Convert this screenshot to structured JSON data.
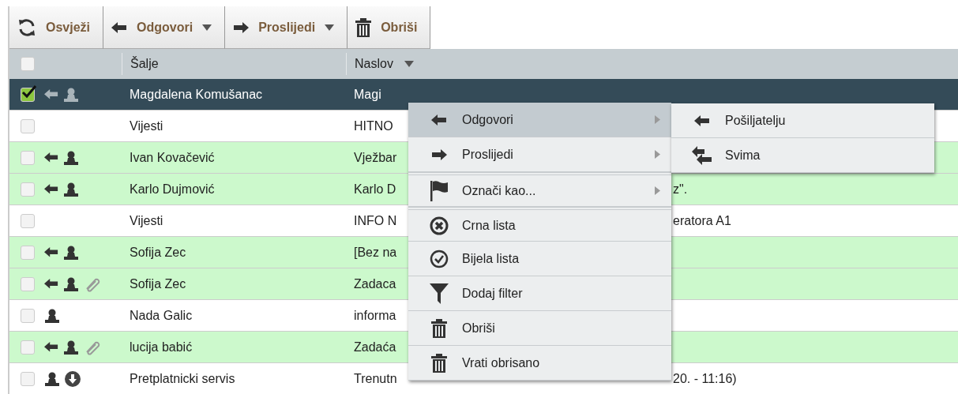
{
  "toolbar": [
    {
      "label": "Osvježi",
      "dropdown": false
    },
    {
      "label": "Odgovori",
      "dropdown": true
    },
    {
      "label": "Proslijedi",
      "dropdown": true
    },
    {
      "label": "Obriši",
      "dropdown": false
    }
  ],
  "table": {
    "select_all_checked": false,
    "columns": [
      {
        "label": "Šalje",
        "sortable": false
      },
      {
        "label": "Naslov",
        "sortable": true
      }
    ],
    "rows": [
      {
        "sender": "Magdalena Komušanac",
        "subject": "Magi",
        "checked": true,
        "selected": true,
        "highlighted": false,
        "status_icons": [
          {
            "kind": "replied"
          },
          {
            "kind": "contact"
          }
        ]
      },
      {
        "sender": "Vijesti",
        "subject": "HITNO",
        "checked": false,
        "selected": false,
        "highlighted": false
      },
      {
        "sender": "Ivan Kovačević",
        "subject": "Vježbar",
        "checked": false,
        "selected": false,
        "highlighted": true,
        "status_icons": [
          {
            "kind": "replied"
          },
          {
            "kind": "contact"
          }
        ]
      },
      {
        "sender": "Karlo Dujmović",
        "subject": "Karlo D",
        "subject_tail": "z\".",
        "checked": false,
        "selected": false,
        "highlighted": true,
        "status_icons": [
          {
            "kind": "replied"
          },
          {
            "kind": "contact"
          }
        ]
      },
      {
        "sender": "Vijesti",
        "subject": "INFO N",
        "subject_tail": "eratora A1",
        "checked": false,
        "selected": false,
        "highlighted": false
      },
      {
        "sender": "Sofija Zec",
        "subject": "[Bez na",
        "checked": false,
        "selected": false,
        "highlighted": true,
        "status_icons": [
          {
            "kind": "replied"
          },
          {
            "kind": "contact"
          }
        ]
      },
      {
        "sender": "Sofija Zec",
        "subject": "Zadaca",
        "checked": false,
        "selected": false,
        "highlighted": true,
        "status_icons": [
          {
            "kind": "replied"
          },
          {
            "kind": "contact"
          },
          {
            "kind": "attachment"
          }
        ]
      },
      {
        "sender": "Nada Galic",
        "subject": "informa",
        "checked": false,
        "selected": false,
        "highlighted": false,
        "status_icons": [
          {
            "kind": "contact"
          }
        ]
      },
      {
        "sender": "lucija babić",
        "subject": "Zadaća",
        "checked": false,
        "selected": false,
        "highlighted": true,
        "status_icons": [
          {
            "kind": "replied"
          },
          {
            "kind": "contact"
          },
          {
            "kind": "attachment"
          }
        ]
      },
      {
        "sender": "Pretplatnicki servis",
        "subject": "Trenutn",
        "subject_tail": "20. - 11:16)",
        "checked": false,
        "selected": false,
        "highlighted": false,
        "status_icons": [
          {
            "kind": "contact"
          },
          {
            "kind": "download"
          }
        ]
      }
    ]
  },
  "context_menu": {
    "groups": [
      [
        {
          "label": "Odgovori",
          "submenu": true,
          "highlighted": true
        },
        {
          "label": "Proslijedi",
          "submenu": true,
          "highlighted": false
        }
      ],
      [
        {
          "label": "Označi kao...",
          "submenu": true,
          "highlighted": false
        }
      ],
      [
        {
          "label": "Crna lista",
          "submenu": false,
          "highlighted": false
        },
        {
          "label": "Bijela lista",
          "submenu": false,
          "highlighted": false
        },
        {
          "label": "Dodaj filter",
          "submenu": false,
          "highlighted": false
        },
        {
          "label": "Obriši",
          "submenu": false,
          "highlighted": false
        },
        {
          "label": "Vrati obrisano",
          "submenu": false,
          "highlighted": false
        }
      ]
    ],
    "submenu": {
      "items": [
        {
          "label": "Pošiljatelju",
          "highlighted": false
        },
        {
          "label": "Svima",
          "highlighted": false
        }
      ]
    }
  }
}
